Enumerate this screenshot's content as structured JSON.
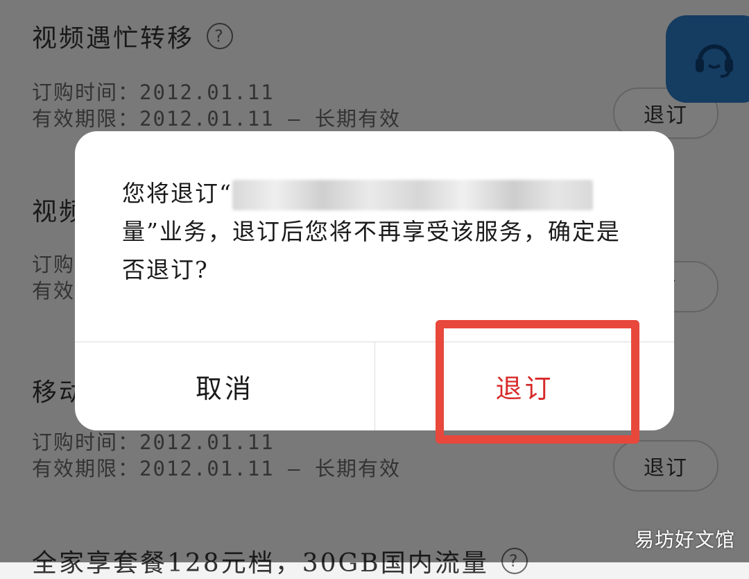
{
  "services": [
    {
      "title": "视频遇忙转移",
      "show_help": true,
      "order_label": "订购时间：2012.01.11",
      "valid_label": "有效期限：2012.01.11 — 长期有效",
      "button": "退订"
    },
    {
      "title": "视频",
      "show_help": false,
      "order_label": "订购",
      "valid_label": "有效",
      "button": "订"
    },
    {
      "title": "移动",
      "show_help": false,
      "order_label": "订购时间：2012.01.11",
      "valid_label": "有效期限：2012.01.11 — 长期有效",
      "button": "退订"
    },
    {
      "title": "全家享套餐128元档，30GB国内流量",
      "show_help": true
    }
  ],
  "support_fab": {
    "icon": "headset-icon"
  },
  "dialog": {
    "message_prefix": "您将退订“",
    "message_line1_end": "量",
    "message_rest": "”业务，退订后您将不再享受该服务，确定是否退订?",
    "cancel_label": "取消",
    "confirm_label": "退订",
    "confirm_color": "#d72b2b"
  },
  "annotation": {
    "highlight_color": "#e8473c"
  },
  "watermark": "易坊好文馆"
}
